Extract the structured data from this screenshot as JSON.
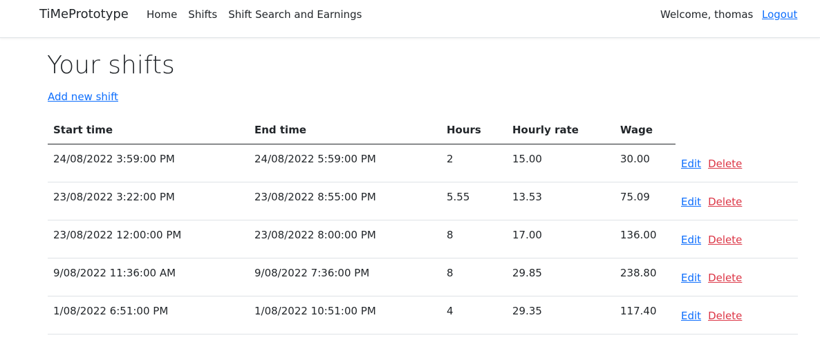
{
  "navbar": {
    "brand": "TiMePrototype",
    "links": [
      {
        "label": "Home"
      },
      {
        "label": "Shifts"
      },
      {
        "label": "Shift Search and Earnings"
      }
    ],
    "welcome": "Welcome, thomas",
    "logout": "Logout"
  },
  "main": {
    "title": "Your shifts",
    "add_link": "Add new shift",
    "table": {
      "headers": [
        "Start time",
        "End time",
        "Hours",
        "Hourly rate",
        "Wage"
      ],
      "rows": [
        {
          "start": "24/08/2022 3:59:00 PM",
          "end": "24/08/2022 5:59:00 PM",
          "hours": "2",
          "rate": "15.00",
          "wage": "30.00",
          "edit": "Edit",
          "delete": "Delete"
        },
        {
          "start": "23/08/2022 3:22:00 PM",
          "end": "23/08/2022 8:55:00 PM",
          "hours": "5.55",
          "rate": "13.53",
          "wage": "75.09",
          "edit": "Edit",
          "delete": "Delete"
        },
        {
          "start": "23/08/2022 12:00:00 PM",
          "end": "23/08/2022 8:00:00 PM",
          "hours": "8",
          "rate": "17.00",
          "wage": "136.00",
          "edit": "Edit",
          "delete": "Delete"
        },
        {
          "start": "9/08/2022 11:36:00 AM",
          "end": "9/08/2022 7:36:00 PM",
          "hours": "8",
          "rate": "29.85",
          "wage": "238.80",
          "edit": "Edit",
          "delete": "Delete"
        },
        {
          "start": "1/08/2022 6:51:00 PM",
          "end": "1/08/2022 10:51:00 PM",
          "hours": "4",
          "rate": "29.35",
          "wage": "117.40",
          "edit": "Edit",
          "delete": "Delete"
        }
      ]
    }
  },
  "colors": {
    "link": "#0d6efd",
    "danger": "#dc3545",
    "text": "#212529",
    "border": "#dee2e6"
  }
}
